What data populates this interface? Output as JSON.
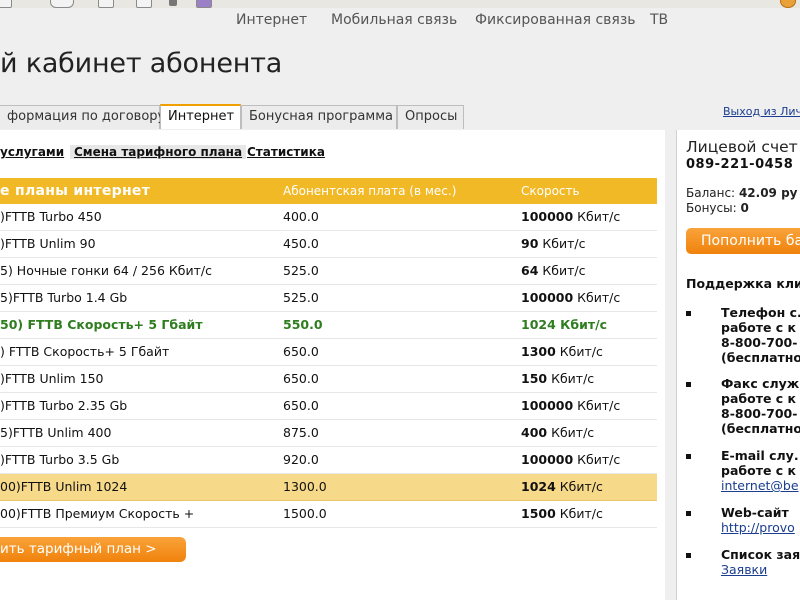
{
  "colors": {
    "accent": "#f2b926",
    "button": "#f0820c",
    "current_plan": "#2e7d1f",
    "selected_row": "#f7d98a",
    "link": "#1a3d8f"
  },
  "top_nav": [
    "Интернет",
    "Мобильная связь",
    "Фиксированная связь",
    "ТВ"
  ],
  "page_title": "й кабинет абонента",
  "tabs": [
    {
      "label": "формация по договору",
      "active": false
    },
    {
      "label": "Интернет",
      "active": true
    },
    {
      "label": "Бонусная программа",
      "active": false
    },
    {
      "label": "Опросы",
      "active": false
    }
  ],
  "logout_link": "Выход из Лич",
  "subnav": [
    {
      "label": "услугами",
      "active": false
    },
    {
      "label": "Смена тарифного плана",
      "active": true
    },
    {
      "label": "Статистика",
      "active": false
    }
  ],
  "table": {
    "headers": [
      "е планы интернет",
      "Абонентская плата (в мес.)",
      "Скорость"
    ],
    "rows": [
      {
        "name": ")FTTB Turbo 450",
        "fee": "400.0",
        "speed_value": "100000",
        "speed_unit": "Кбит/с",
        "state": "normal"
      },
      {
        "name": ")FTTB Unlim 90",
        "fee": "450.0",
        "speed_value": "90",
        "speed_unit": "Кбит/с",
        "state": "normal"
      },
      {
        "name": "5) Ночные гонки 64 / 256 Кбит/с",
        "fee": "525.0",
        "speed_value": "64",
        "speed_unit": "Кбит/с",
        "state": "normal"
      },
      {
        "name": "5)FTTB Turbo 1.4 Gb",
        "fee": "525.0",
        "speed_value": "100000",
        "speed_unit": "Кбит/с",
        "state": "normal"
      },
      {
        "name": "50) FTTB Скорость+ 5 Гбайт",
        "fee": "550.0",
        "speed_value": "1024",
        "speed_unit": "Кбит/с",
        "state": "current"
      },
      {
        "name": ") FTTB Скорость+ 5 Гбайт",
        "fee": "650.0",
        "speed_value": "1300",
        "speed_unit": "Кбит/с",
        "state": "normal"
      },
      {
        "name": ")FTTB Unlim 150",
        "fee": "650.0",
        "speed_value": "150",
        "speed_unit": "Кбит/с",
        "state": "normal"
      },
      {
        "name": ")FTTB Turbo 2.35 Gb",
        "fee": "650.0",
        "speed_value": "100000",
        "speed_unit": "Кбит/с",
        "state": "normal"
      },
      {
        "name": "5)FTTB Unlim 400",
        "fee": "875.0",
        "speed_value": "400",
        "speed_unit": "Кбит/с",
        "state": "normal"
      },
      {
        "name": ")FTTB Turbo 3.5 Gb",
        "fee": "920.0",
        "speed_value": "100000",
        "speed_unit": "Кбит/с",
        "state": "normal"
      },
      {
        "name": "00)FTTB Unlim 1024",
        "fee": "1300.0",
        "speed_value": "1024",
        "speed_unit": "Кбит/с",
        "state": "selected"
      },
      {
        "name": "00)FTTB Премиум Скорость +",
        "fee": "1500.0",
        "speed_value": "1500",
        "speed_unit": "Кбит/с",
        "state": "normal"
      }
    ]
  },
  "change_button": "ить тарифный план >",
  "account": {
    "label": "Лицевой счет",
    "number": "089-221-0458",
    "balance_label": "Баланс:",
    "balance_value": "42.09 ру",
    "bonus_label": "Бонусы:",
    "bonus_value": "0",
    "topup_button": "Пополнить ба"
  },
  "support": {
    "title": "Поддержка кли",
    "items": [
      {
        "lines": [
          "Телефон с.",
          "работе с к",
          "8-800-700-",
          "(бесплатно"
        ],
        "link": ""
      },
      {
        "lines": [
          "Факс служ",
          "работе с к",
          "8-800-700-",
          "(бесплатно"
        ],
        "link": ""
      },
      {
        "lines": [
          "E-mail слу.",
          "работе с к"
        ],
        "link": "internet@be"
      },
      {
        "lines": [
          "Web-сайт"
        ],
        "link": "http://provo"
      },
      {
        "lines": [
          "Список зая"
        ],
        "link": "Заявки"
      }
    ]
  }
}
